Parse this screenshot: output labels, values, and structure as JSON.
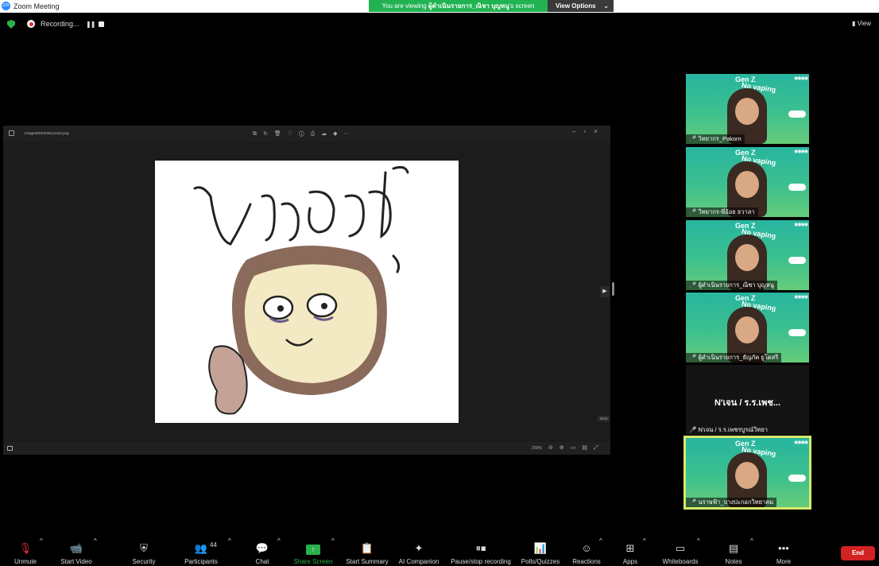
{
  "window": {
    "title": "Zoom Meeting"
  },
  "banner": {
    "prefix": "You are viewing ",
    "presenter": "ผู้ดำเนินรายการ_ณิชา บุญหนู",
    "suffix": "'s screen"
  },
  "view_options": {
    "label": "View Options"
  },
  "recording": {
    "label": "Recording..."
  },
  "view_button": {
    "label": "View"
  },
  "shared_screen": {
    "file_name": "Image20240430111422.png",
    "zoom_level": "259%",
    "next_label": "Next"
  },
  "participants": [
    {
      "name": "วิทยากร_Pakorn"
    },
    {
      "name": "วิทยากร-พี่อ้อย ธวาลา"
    },
    {
      "name": "ผู้ดำเนินรายการ_ณิชา บุญหนู"
    },
    {
      "name": "ผู้ดำเนินรายการ_ธัญภัค ยูโดสริ"
    },
    {
      "name": "N'เจน / ร.ร.เพชรบูรณ์วิทยา",
      "display": "N'เจน / ร.ร.เพช..."
    },
    {
      "name": "นราษฟ้า_บางปะกอกวิทยาคม"
    }
  ],
  "tile_text": {
    "gen": "Gen Z",
    "vaping": "No vaping"
  },
  "toolbar": {
    "unmute": "Unmute",
    "start_video": "Start Video",
    "security": "Security",
    "participants": "Participants",
    "participants_count": "44",
    "chat": "Chat",
    "share_screen": "Share Screen",
    "start_summary": "Start Summary",
    "ai_companion": "AI Companion",
    "pause_recording": "Pause/stop recording",
    "polls": "Polls/Quizzes",
    "reactions": "Reactions",
    "apps": "Apps",
    "whiteboards": "Whiteboards",
    "notes": "Notes",
    "more": "More",
    "end": "End"
  },
  "colors": {
    "accent_green": "#21b352",
    "end_red": "#d32222",
    "active_speaker": "#d8e86a"
  }
}
